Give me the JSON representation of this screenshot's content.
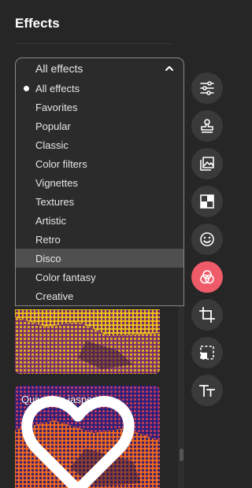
{
  "panel": {
    "title": "Effects"
  },
  "dropdown": {
    "selected": "All effects",
    "options": [
      {
        "label": "All effects",
        "selected": true
      },
      {
        "label": "Favorites"
      },
      {
        "label": "Popular"
      },
      {
        "label": "Classic"
      },
      {
        "label": "Color filters"
      },
      {
        "label": "Vignettes"
      },
      {
        "label": "Textures"
      },
      {
        "label": "Artistic"
      },
      {
        "label": "Retro"
      },
      {
        "label": "Disco",
        "highlighted": true
      },
      {
        "label": "Color fantasy"
      },
      {
        "label": "Creative"
      }
    ]
  },
  "cards": [
    {
      "label": "",
      "colors": [
        "#f2c21a",
        "#7a2f6e"
      ]
    },
    {
      "label": "Quivering jasper",
      "colors": [
        "#f26a1e",
        "#2a1f7a"
      ]
    }
  ],
  "toolbar": {
    "items": [
      {
        "name": "adjustments",
        "icon": "sliders-icon"
      },
      {
        "name": "stamp",
        "icon": "stamp-icon"
      },
      {
        "name": "image",
        "icon": "image-icon"
      },
      {
        "name": "patterns",
        "icon": "checker-icon"
      },
      {
        "name": "stickers",
        "icon": "smiley-icon"
      },
      {
        "name": "effects",
        "icon": "color-circles-icon",
        "active": true
      },
      {
        "name": "crop",
        "icon": "crop-icon"
      },
      {
        "name": "resize",
        "icon": "resize-icon"
      },
      {
        "name": "text",
        "icon": "text-icon"
      }
    ],
    "active_color": "#ef5b68"
  }
}
